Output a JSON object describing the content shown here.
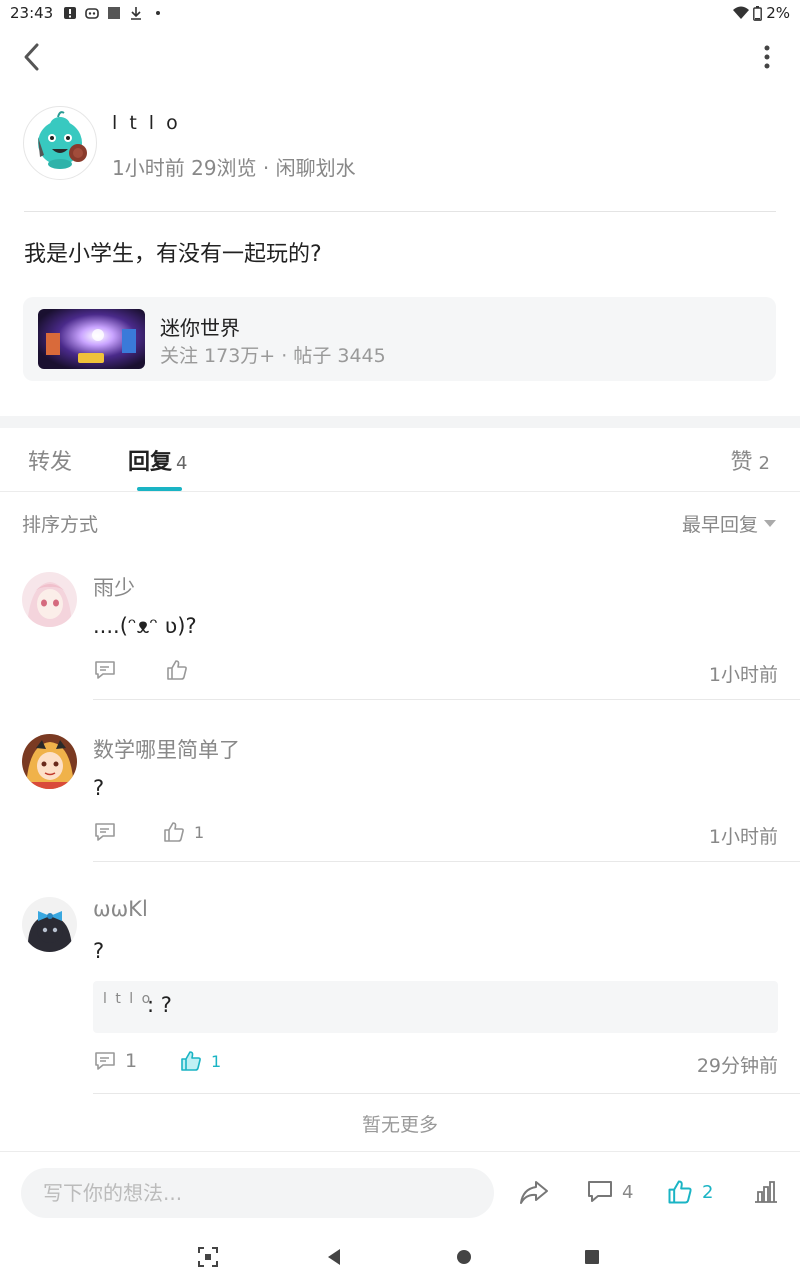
{
  "status_bar": {
    "time": "23:43",
    "battery": "2%"
  },
  "post": {
    "author": "l t l o",
    "time": "1小时前",
    "views": "29浏览",
    "separator": "·",
    "board": "闲聊划水",
    "content": "我是小学生，有没有一起玩的?"
  },
  "game_card": {
    "name": "迷你世界",
    "stats": "关注 173万+ · 帖子 3445"
  },
  "tabs": {
    "forward": "转发",
    "reply": "回复",
    "reply_count": "4",
    "like": "赞",
    "like_count": "2"
  },
  "sort": {
    "label": "排序方式",
    "value": "最早回复"
  },
  "comments": [
    {
      "name": "雨少",
      "text": "....(ᵔᴥᵔ ʋ)?",
      "reply_count": "",
      "like_count": "",
      "time": "1小时前"
    },
    {
      "name": "数学哪里简单了",
      "text": "?",
      "reply_count": "",
      "like_count": "1",
      "time": "1小时前"
    },
    {
      "name": "ωωKl",
      "text": "?",
      "quote_name": "l t l o",
      "quote_text": ": ?",
      "reply_count": "1",
      "like_count": "1",
      "time": "29分钟前"
    }
  ],
  "no_more": "暂无更多",
  "bottom_bar": {
    "placeholder": "写下你的想法...",
    "comment_count": "4",
    "like_count": "2"
  },
  "colors": {
    "accent": "#1ab4c4",
    "muted": "#888888",
    "card_bg": "#f5f6f7"
  },
  "icons": [
    "back-arrow-icon",
    "more-vertical-icon",
    "comment-icon",
    "thumb-up-icon",
    "share-icon",
    "stats-icon",
    "wifi-icon",
    "battery-icon"
  ]
}
